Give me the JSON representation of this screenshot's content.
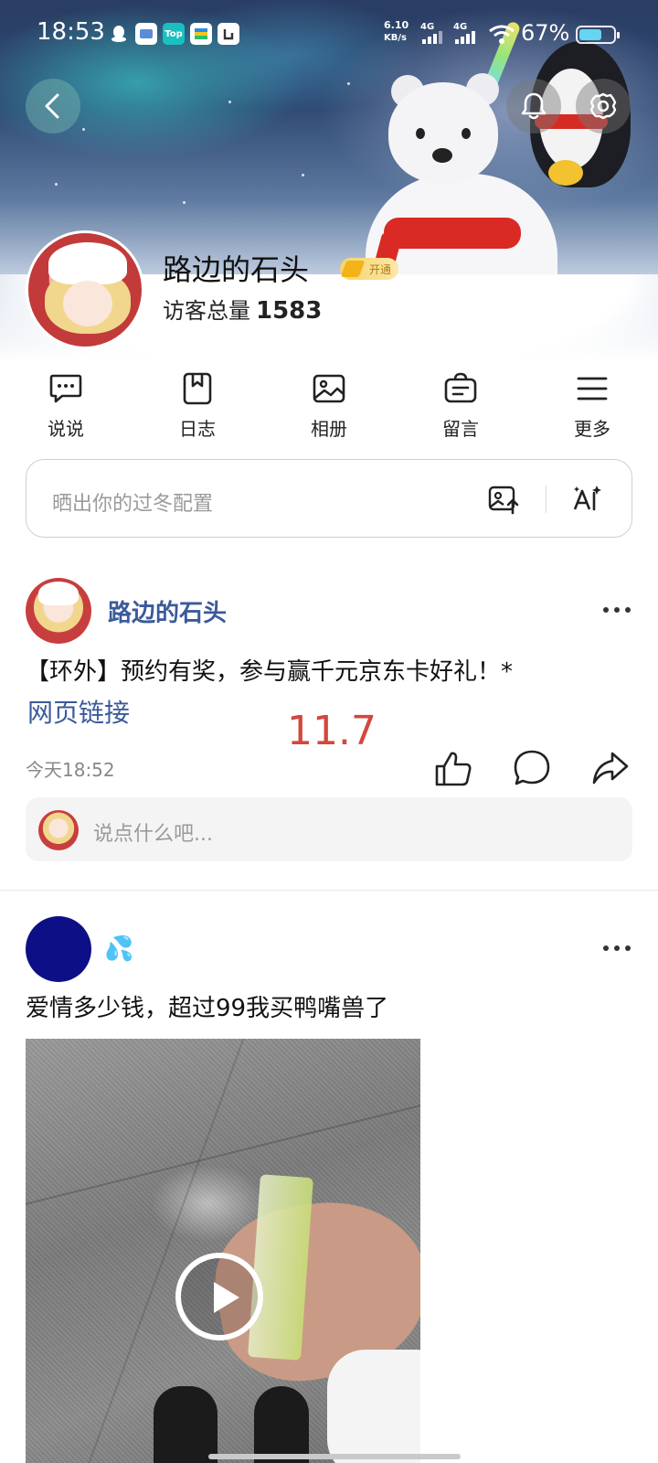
{
  "status_bar": {
    "time": "18:53",
    "net_speed": "6.10",
    "net_unit": "KB/s",
    "net_type_1": "4G",
    "net_type_2": "4G",
    "battery": "67%",
    "battery_level": 0.67,
    "app_icons": [
      "qq-icon",
      "notification-app-icon",
      "top-app-icon",
      "card-app-icon",
      "shortcut-app-icon"
    ],
    "top_badge": "Top"
  },
  "profile": {
    "name": "路边的石头",
    "vip_label": "开通",
    "visitors_label": "访客总量",
    "visitors_count": "1583"
  },
  "tabs": [
    {
      "label": "说说",
      "icon": "chat-bubble-icon"
    },
    {
      "label": "日志",
      "icon": "bookmark-icon"
    },
    {
      "label": "相册",
      "icon": "photo-icon"
    },
    {
      "label": "留言",
      "icon": "message-bag-icon"
    },
    {
      "label": "更多",
      "icon": "menu-icon"
    }
  ],
  "composer": {
    "placeholder": "晒出你的过冬配置"
  },
  "posts": [
    {
      "author": "路边的石头",
      "text": "【环外】预约有奖，参与赢千元京东卡好礼！*",
      "link": "网页链接",
      "overlay_value": "11.7",
      "time": "今天18:52",
      "comment_placeholder": "说点什么吧..."
    },
    {
      "author_emoji": "💦",
      "text": "爱情多少钱，超过99我买鸭嘴兽了"
    }
  ],
  "colors": {
    "link": "#3a5a9a",
    "overlay_number": "#d2473f",
    "vip_gold": "#f2b318",
    "avatar_blue": "#0d0f86"
  }
}
